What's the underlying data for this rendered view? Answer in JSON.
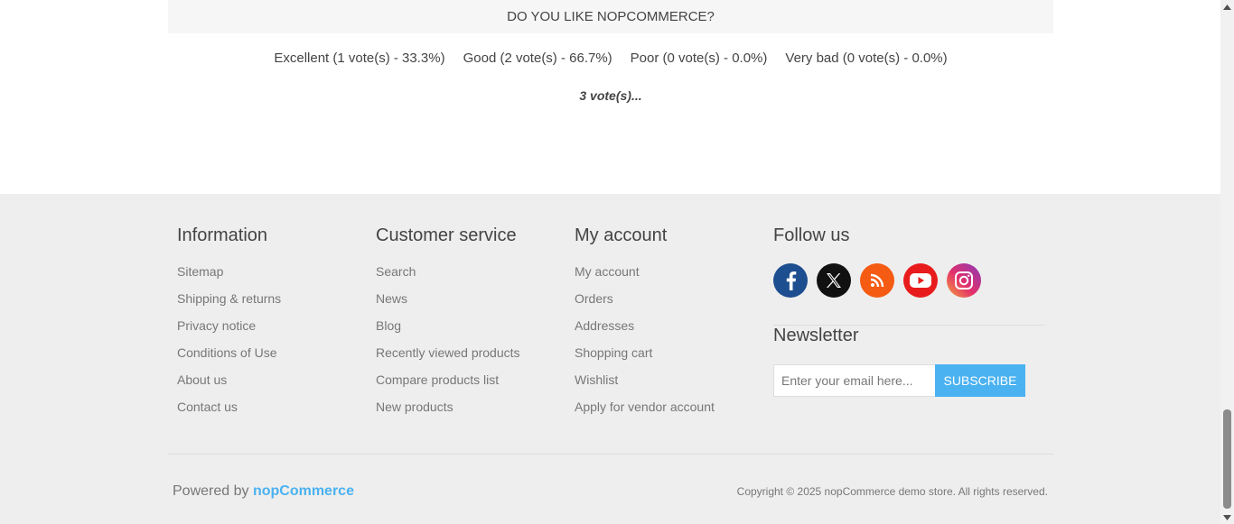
{
  "poll": {
    "question": "DO YOU LIKE NOPCOMMERCE?",
    "results": [
      {
        "label": "Excellent (1 vote(s) - 33.3%)"
      },
      {
        "label": "Good (2 vote(s) - 66.7%)"
      },
      {
        "label": "Poor (0 vote(s) - 0.0%)"
      },
      {
        "label": "Very bad (0 vote(s) - 0.0%)"
      }
    ],
    "total": "3 vote(s)..."
  },
  "footer": {
    "information": {
      "title": "Information",
      "links": [
        "Sitemap",
        "Shipping & returns",
        "Privacy notice",
        "Conditions of Use",
        "About us",
        "Contact us"
      ]
    },
    "customer_service": {
      "title": "Customer service",
      "links": [
        "Search",
        "News",
        "Blog",
        "Recently viewed products",
        "Compare products list",
        "New products"
      ]
    },
    "my_account": {
      "title": "My account",
      "links": [
        "My account",
        "Orders",
        "Addresses",
        "Shopping cart",
        "Wishlist",
        "Apply for vendor account"
      ]
    },
    "follow_us": {
      "title": "Follow us",
      "icons": [
        {
          "name": "facebook-icon",
          "color": "#1d4e8f"
        },
        {
          "name": "x-twitter-icon",
          "color": "#111111"
        },
        {
          "name": "rss-icon",
          "color": "#f55b12"
        },
        {
          "name": "youtube-icon",
          "color": "#e81c1c"
        },
        {
          "name": "instagram-icon",
          "color": "#b43ac8"
        }
      ]
    },
    "newsletter": {
      "title": "Newsletter",
      "placeholder": "Enter your email here...",
      "button": "SUBSCRIBE"
    },
    "powered_by_prefix": "Powered by",
    "powered_by_brand": "nopCommerce",
    "copyright": "Copyright © 2025 nopCommerce demo store. All rights reserved."
  },
  "colors": {
    "accent": "#4ab2f1",
    "footer_bg": "#eeeeee"
  }
}
